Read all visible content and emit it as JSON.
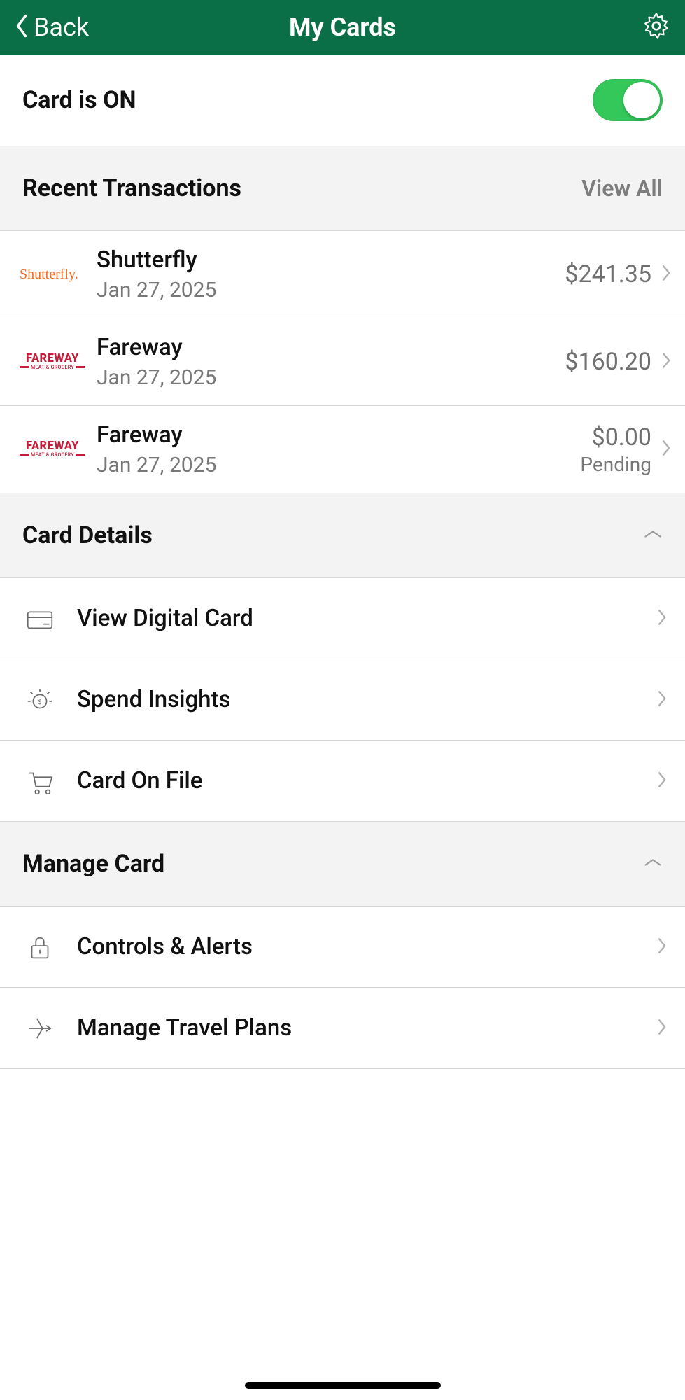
{
  "header": {
    "back_label": "Back",
    "title": "My Cards"
  },
  "card_status": {
    "label": "Card is ON",
    "on": true
  },
  "recent_transactions": {
    "title": "Recent Transactions",
    "view_all_label": "View All",
    "items": [
      {
        "merchant": "Shutterfly",
        "date": "Jan 27, 2025",
        "amount": "$241.35",
        "status": "",
        "logo": "shutterfly"
      },
      {
        "merchant": "Fareway",
        "date": "Jan 27, 2025",
        "amount": "$160.20",
        "status": "",
        "logo": "fareway"
      },
      {
        "merchant": "Fareway",
        "date": "Jan 27, 2025",
        "amount": "$0.00",
        "status": "Pending",
        "logo": "fareway"
      }
    ]
  },
  "card_details": {
    "title": "Card Details",
    "items": [
      {
        "label": "View Digital Card",
        "icon": "card"
      },
      {
        "label": "Spend Insights",
        "icon": "insights"
      },
      {
        "label": "Card On File",
        "icon": "cart"
      }
    ]
  },
  "manage_card": {
    "title": "Manage Card",
    "items": [
      {
        "label": "Controls & Alerts",
        "icon": "lock"
      },
      {
        "label": "Manage Travel Plans",
        "icon": "plane"
      }
    ]
  },
  "logos": {
    "shutterfly_text": "Shutterfly.",
    "fareway_text": "FAREWAY",
    "fareway_sub": "MEAT & GROCERY"
  }
}
